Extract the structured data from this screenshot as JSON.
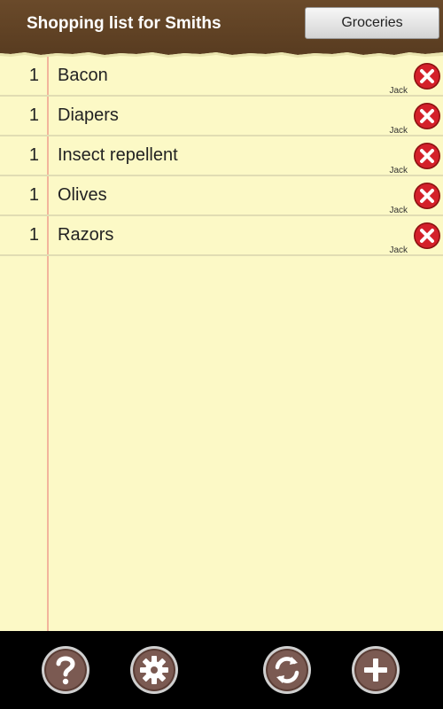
{
  "header": {
    "title": "Shopping list for Smiths",
    "list_selector_label": "Groceries"
  },
  "items": [
    {
      "qty": "1",
      "name": "Bacon",
      "owner": "Jack"
    },
    {
      "qty": "1",
      "name": "Diapers",
      "owner": "Jack"
    },
    {
      "qty": "1",
      "name": "Insect repellent",
      "owner": "Jack"
    },
    {
      "qty": "1",
      "name": "Olives",
      "owner": "Jack"
    },
    {
      "qty": "1",
      "name": "Razors",
      "owner": "Jack"
    }
  ],
  "toolbar": {
    "buttons": [
      {
        "icon": "help-icon"
      },
      {
        "icon": "settings-gear-icon"
      },
      {
        "icon": "sync-icon"
      },
      {
        "icon": "add-icon"
      }
    ]
  },
  "colors": {
    "header_bg": "#5a3d21",
    "paper_bg": "#fcf9c6",
    "margin_line": "#f2b59c",
    "row_divider": "#e1ddb3",
    "delete_red": "#d4202a",
    "toolbar_bg": "#000000"
  }
}
